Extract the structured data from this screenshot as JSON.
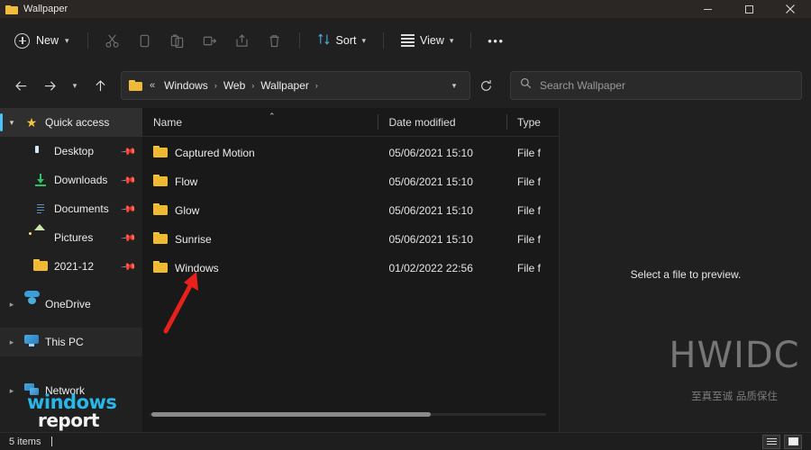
{
  "window": {
    "tab_title": "Wallpaper",
    "tab_icon": "folder-icon",
    "controls": [
      {
        "name": "minimize",
        "glyph": "minimize-icon"
      },
      {
        "name": "maximize",
        "glyph": "maximize-icon"
      },
      {
        "name": "close",
        "glyph": "close-icon"
      }
    ]
  },
  "command_bar": {
    "new_label": "New",
    "new_icon": "plus-circle-icon",
    "chevron": "⌄",
    "icons": [
      {
        "name": "cut-icon",
        "title": "Cut"
      },
      {
        "name": "copy-icon",
        "title": "Copy"
      },
      {
        "name": "paste-icon",
        "title": "Paste"
      },
      {
        "name": "rename-icon",
        "title": "Rename"
      },
      {
        "name": "share-icon",
        "title": "Share"
      },
      {
        "name": "delete-icon",
        "title": "Delete"
      }
    ],
    "sort_label": "Sort",
    "sort_icon": "sort-arrows-icon",
    "view_label": "View",
    "view_icon": "list-lines-icon",
    "more_label": "•••",
    "more_icon": "ellipsis-icon"
  },
  "navigation": {
    "back_icon": "arrow-left-icon",
    "forward_icon": "arrow-right-icon",
    "recent_icon": "chevron-down-icon",
    "up_icon": "arrow-up-icon"
  },
  "address_bar": {
    "folder_icon": "folder-icon",
    "overflow": "«",
    "crumbs": [
      "Windows",
      "Web",
      "Wallpaper"
    ],
    "separator": "›",
    "dropdown_icon": "chevron-down-icon",
    "refresh_icon": "refresh-icon"
  },
  "search": {
    "icon": "search-icon",
    "placeholder": "Search Wallpaper",
    "value": ""
  },
  "sidebar": {
    "items": [
      {
        "label": "Quick access",
        "icon": "star-icon",
        "expander": "down",
        "level": 0,
        "selected": true,
        "pinned": false
      },
      {
        "label": "Desktop",
        "icon": "desktop-icon",
        "expander": "none",
        "level": 1,
        "selected": false,
        "pinned": true
      },
      {
        "label": "Downloads",
        "icon": "download-icon",
        "expander": "none",
        "level": 1,
        "selected": false,
        "pinned": true
      },
      {
        "label": "Documents",
        "icon": "document-icon",
        "expander": "none",
        "level": 1,
        "selected": false,
        "pinned": true
      },
      {
        "label": "Pictures",
        "icon": "pictures-icon",
        "expander": "none",
        "level": 1,
        "selected": false,
        "pinned": true
      },
      {
        "label": "2021-12",
        "icon": "folder-icon",
        "expander": "none",
        "level": 1,
        "selected": false,
        "pinned": true
      },
      {
        "label": "OneDrive",
        "icon": "cloud-icon",
        "expander": "right",
        "level": 0,
        "selected": false,
        "pinned": false
      },
      {
        "label": "This PC",
        "icon": "pc-icon",
        "expander": "right",
        "level": 0,
        "selected": false,
        "pinned": false
      },
      {
        "label": "Network",
        "icon": "network-icon",
        "expander": "right",
        "level": 0,
        "selected": false,
        "pinned": false
      }
    ],
    "pin_glyph": "\u0001"
  },
  "file_list": {
    "columns": [
      {
        "key": "name",
        "label": "Name",
        "sorted": "ascending",
        "sort_glyph": "⌃"
      },
      {
        "key": "date",
        "label": "Date modified",
        "sorted": "none"
      },
      {
        "key": "type",
        "label": "Type",
        "sorted": "none"
      }
    ],
    "rows": [
      {
        "name": "Captured Motion",
        "date": "05/06/2021 15:10",
        "type": "File f",
        "icon": "folder-icon"
      },
      {
        "name": "Flow",
        "date": "05/06/2021 15:10",
        "type": "File f",
        "icon": "folder-icon"
      },
      {
        "name": "Glow",
        "date": "05/06/2021 15:10",
        "type": "File f",
        "icon": "folder-icon"
      },
      {
        "name": "Sunrise",
        "date": "05/06/2021 15:10",
        "type": "File f",
        "icon": "folder-icon"
      },
      {
        "name": "Windows",
        "date": "01/02/2022 22:56",
        "type": "File f",
        "icon": "folder-icon"
      }
    ]
  },
  "preview_pane": {
    "message": "Select a file to preview."
  },
  "status_bar": {
    "item_count": "5 items",
    "details_view_icon": "details-view-icon",
    "large_icons_view_icon": "large-icons-view-icon"
  },
  "annotations": {
    "arrow": {
      "name": "red-arrow-annotation",
      "color": "#e8211b",
      "points_to": "Windows"
    },
    "watermark_main": "HWIDC",
    "watermark_sub": "至真至诚 品质保住",
    "watermark_corner_line1": "windows",
    "watermark_corner_line2": "report"
  },
  "colors": {
    "accent": "#4cc2ff",
    "folder": "#efb934",
    "background": "#202020",
    "list_background": "#191919",
    "annotation_red": "#e8211b",
    "watermark_blue": "#29b6e8"
  }
}
